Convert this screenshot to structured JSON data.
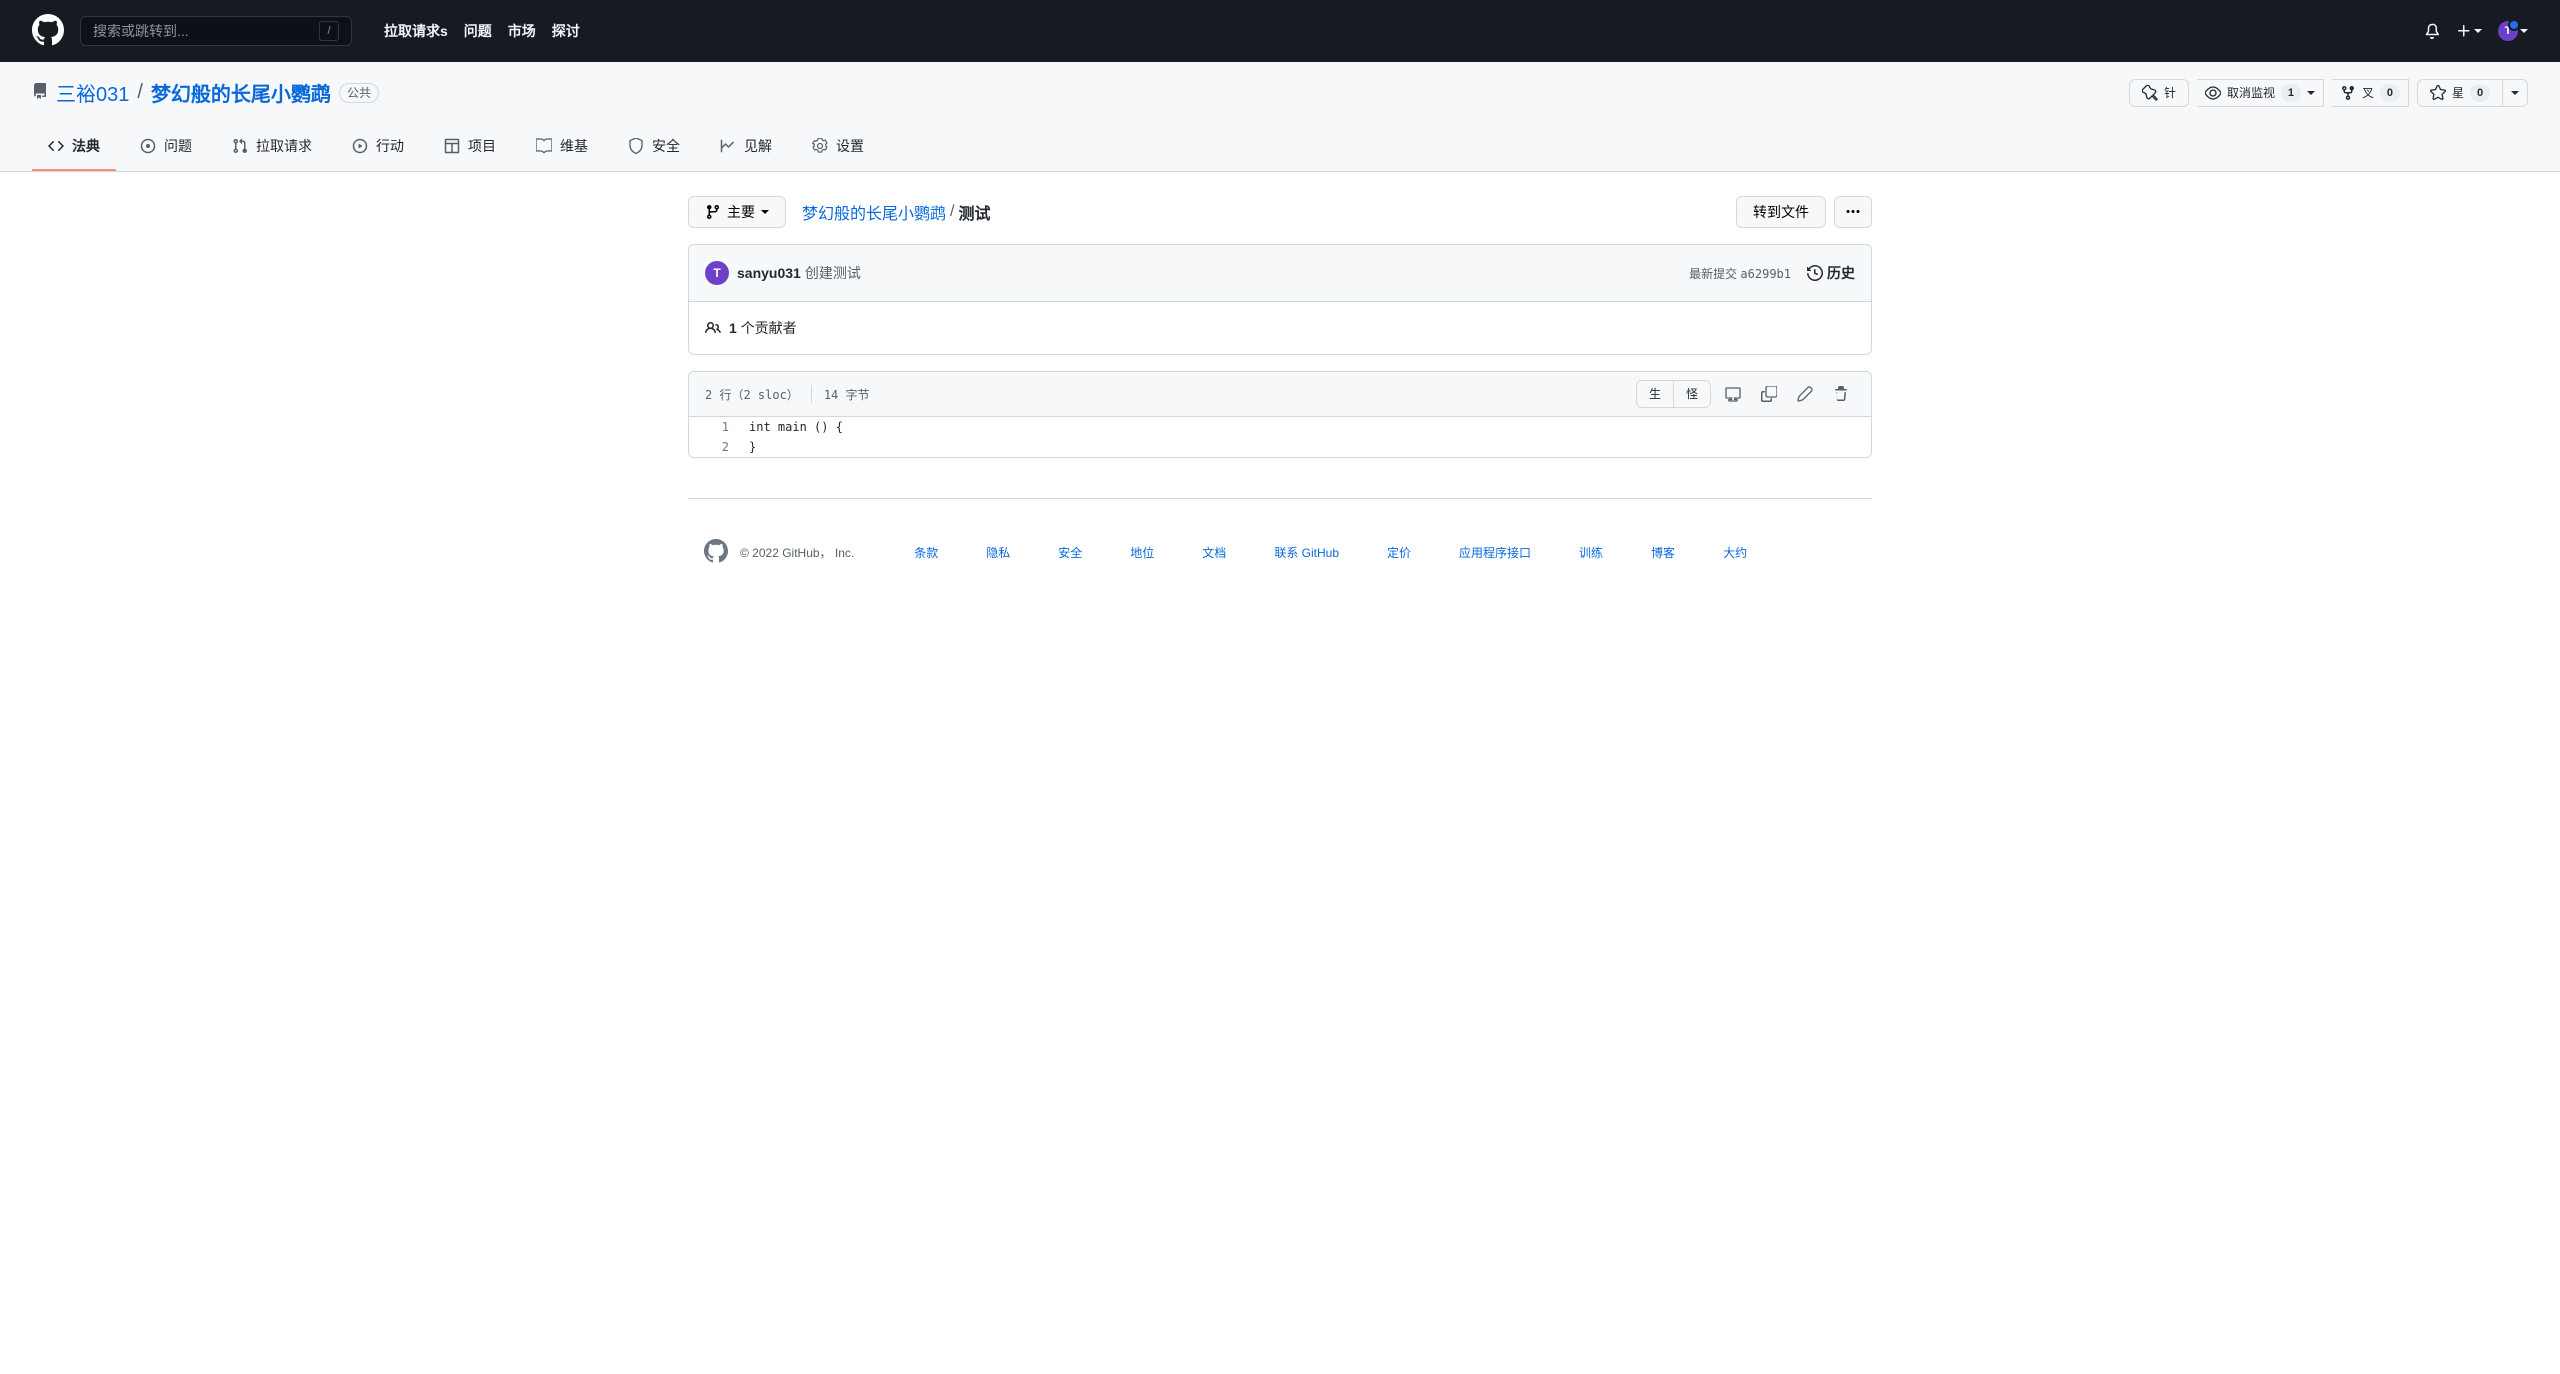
{
  "header": {
    "search_placeholder": "搜索或跳转到...",
    "nav": {
      "pulls": "拉取请求s",
      "issues": "问题",
      "marketplace": "市场",
      "explore": "探讨"
    }
  },
  "repo": {
    "owner": "三裕031",
    "name": "梦幻般的长尾小鹦鹉",
    "visibility": "公共",
    "actions": {
      "pin": "针",
      "unwatch": "取消监视",
      "watch_count": "1",
      "fork": "叉",
      "fork_count": "0",
      "star": "星",
      "star_count": "0"
    }
  },
  "tabs": {
    "code": "法典",
    "issues": "问题",
    "pulls": "拉取请求",
    "actions": "行动",
    "projects": "项目",
    "wiki": "维基",
    "security": "安全",
    "insights": "见解",
    "settings": "设置"
  },
  "file": {
    "branch": "主要",
    "breadcrumb_repo": "梦幻般的长尾小鹦鹉",
    "breadcrumb_file": "测试",
    "goto": "转到文件"
  },
  "commit": {
    "author": "sanyu031",
    "message": "创建测试",
    "latest_label": "最新提交",
    "sha": "a6299b1",
    "history": "历史",
    "contributors_count": "1",
    "contributors_label": "个贡献者"
  },
  "code": {
    "stats_lines": "2 行（2 sloc）",
    "stats_bytes": "14 字节",
    "raw": "生",
    "blame": "怪",
    "lines": [
      {
        "n": "1",
        "c": "int main () {"
      },
      {
        "n": "2",
        "c": "}"
      }
    ]
  },
  "footer": {
    "copyright": "© 2022 GitHub， Inc.",
    "links": {
      "terms": "条款",
      "privacy": "隐私",
      "security": "安全",
      "status": "地位",
      "docs": "文档",
      "contact": "联系 GitHub",
      "pricing": "定价",
      "api": "应用程序接口",
      "training": "训练",
      "blog": "博客",
      "about": "大约"
    }
  }
}
